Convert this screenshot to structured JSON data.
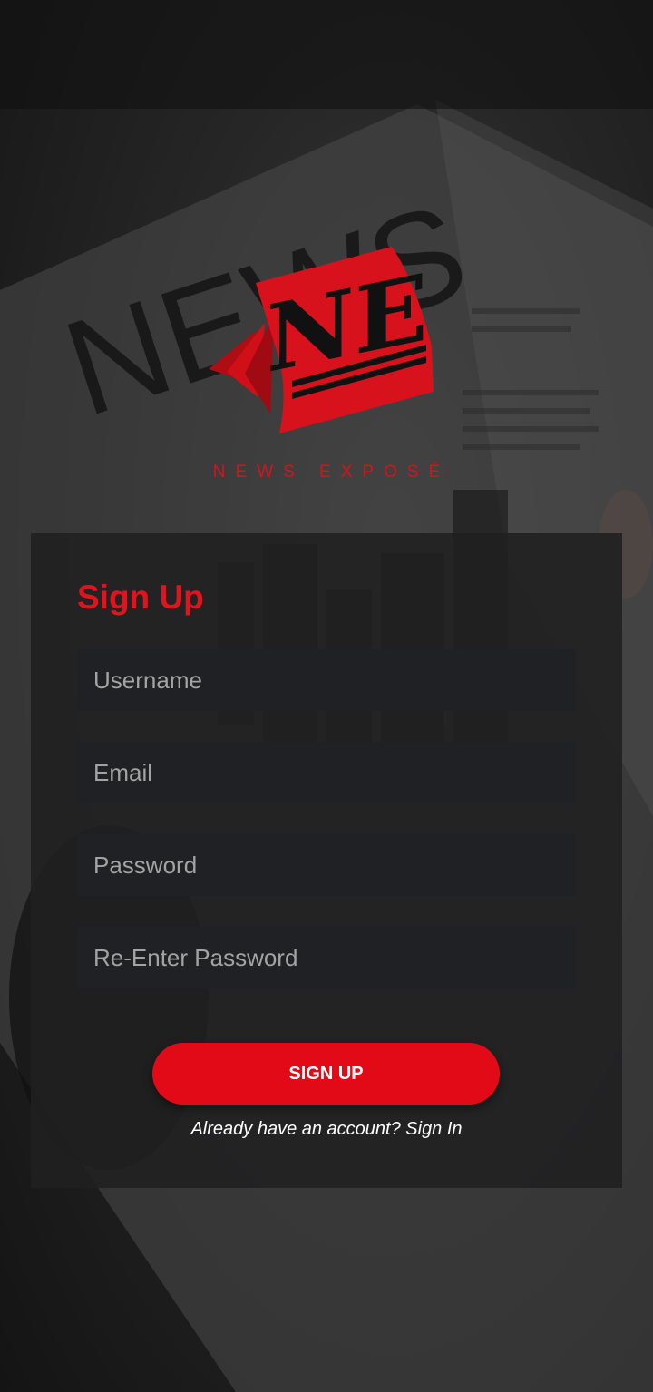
{
  "colors": {
    "accent": "#e10a16",
    "field_bg": "#202124",
    "card_bg": "#202021",
    "placeholder": "#a3a3a3"
  },
  "logo": {
    "monogram": "NE",
    "brand_name": "NEWS EXPOSÉ",
    "background_photo_text": "NEWS"
  },
  "form": {
    "title": "Sign Up",
    "username_placeholder": "Username",
    "email_placeholder": "Email",
    "password_placeholder": "Password",
    "reenter_password_placeholder": "Re-Enter Password",
    "submit_label": "SIGN UP",
    "signin_link": "Already have an account? Sign In"
  }
}
